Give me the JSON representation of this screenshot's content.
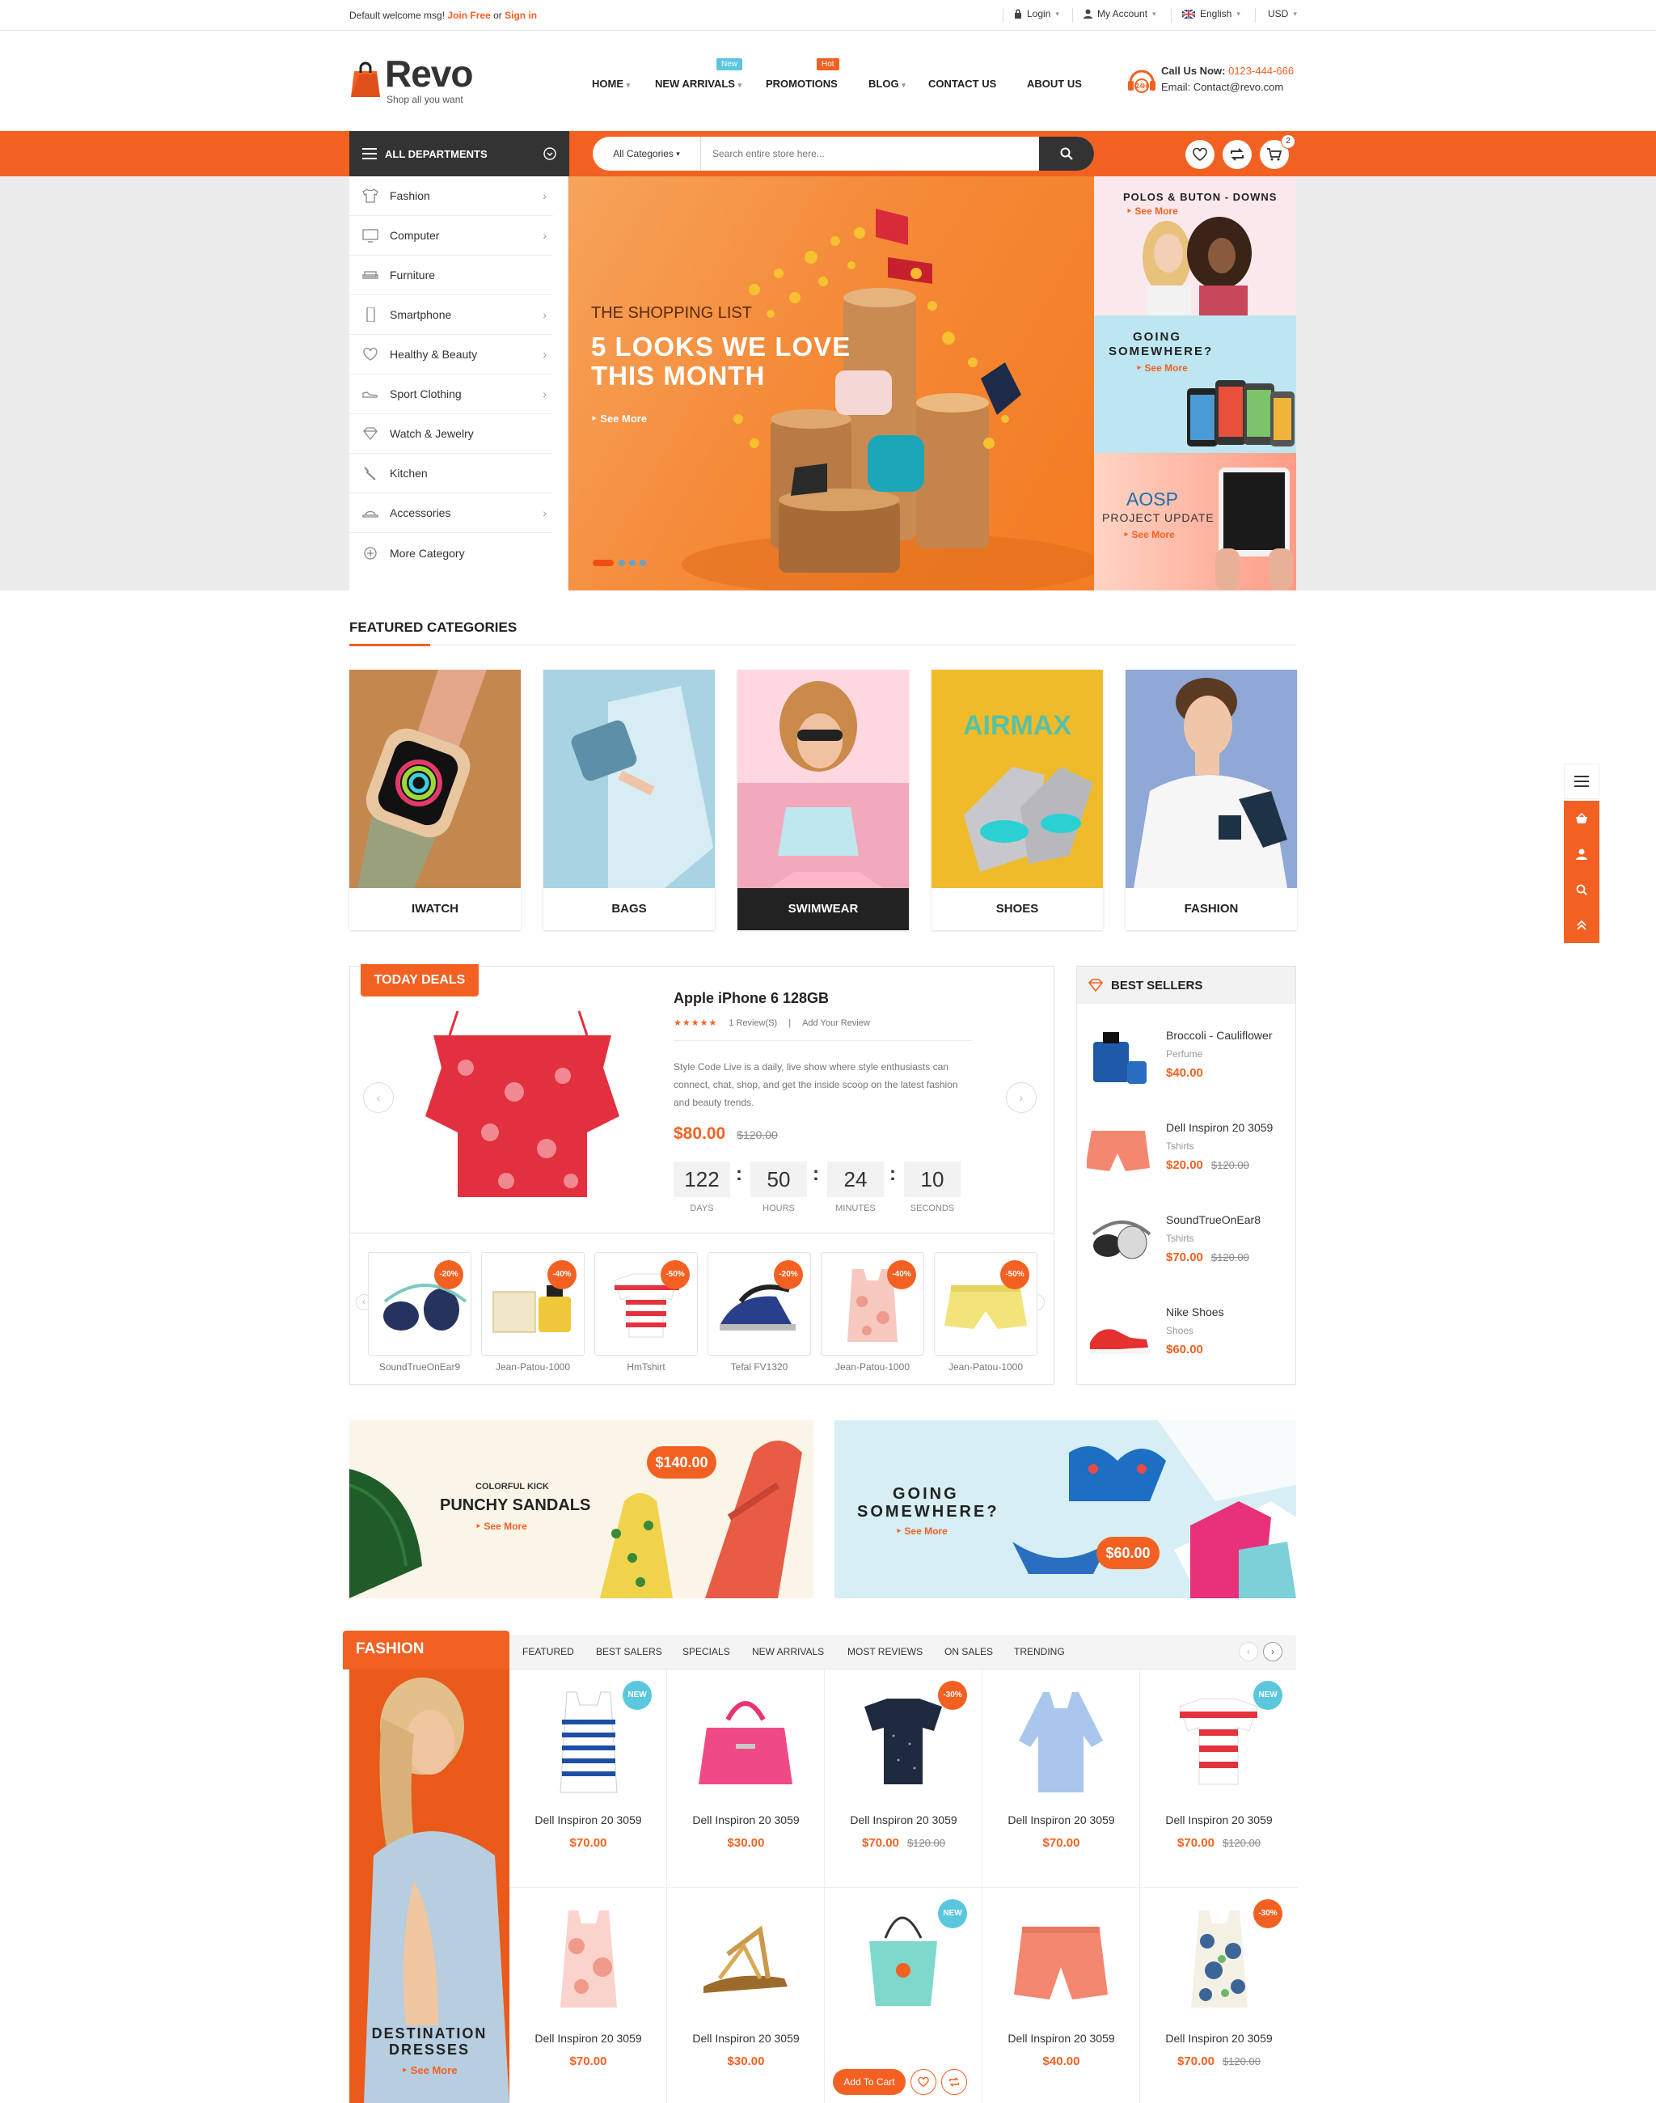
{
  "topbar": {
    "welcome": "Default welcome msg!",
    "join": "Join Free",
    "or": "or",
    "signin": "Sign in",
    "login": "Login",
    "account": "My Account",
    "language": "English",
    "currency": "USD"
  },
  "header": {
    "logo": "Revo",
    "tagline": "Shop all you want",
    "nav": [
      "HOME",
      "NEW ARRIVALS",
      "PROMOTIONS",
      "BLOG",
      "CONTACT US",
      "ABOUT US"
    ],
    "new_tag": "New",
    "hot_tag": "Hot",
    "call_label": "Call Us Now:",
    "phone": "0123-444-666",
    "email_label": "Email:",
    "email": "Contact@revo.com"
  },
  "searchbar": {
    "departments": "ALL DEPARTMENTS",
    "category": "All Categories",
    "placeholder": "Search entire store here...",
    "cart_count": "2"
  },
  "sidebar": {
    "items": [
      "Fashion",
      "Computer",
      "Furniture",
      "Smartphone",
      "Healthy & Beauty",
      "Sport Clothing",
      "Watch & Jewelry",
      "Kitchen",
      "Accessories",
      "More Category"
    ]
  },
  "slider": {
    "kicker": "THE SHOPPING LIST",
    "title1": "5 LOOKS WE LOVE",
    "title2": "THIS MONTH",
    "cta": "See More"
  },
  "side_banners": {
    "b1_title": "POLOS & BUTON - DOWNS",
    "b1_cta": "See More",
    "b2_title1": "GOING",
    "b2_title2": "SOMEWHERE?",
    "b2_cta": "See More",
    "b3_title1": "AOSP",
    "b3_title2": "PROJECT UPDATE",
    "b3_cta": "See More"
  },
  "featured": {
    "heading": "FEATURED CATEGORIES",
    "cats": [
      "IWATCH",
      "BAGS",
      "SWIMWEAR",
      "SHOES",
      "FASHION"
    ]
  },
  "deals": {
    "label": "TODAY DEALS",
    "product": "Apple iPhone 6 128GB",
    "reviews": "1 Review(S)",
    "add_review": "Add Your Review",
    "desc": "Style Code Live is a daily, live show where style enthusiasts can connect, chat, shop, and get the inside scoop on the latest fashion and beauty trends.",
    "price": "$80.00",
    "old_price": "$120.00",
    "countdown": [
      "122",
      "50",
      "24",
      "10"
    ],
    "countdown_labels": [
      "DAYS",
      "HOURS",
      "MINUTES",
      "SECONDS"
    ],
    "rating": 4.5,
    "thumbs": [
      {
        "name": "SoundTrueOnEar9",
        "badge": "-20%"
      },
      {
        "name": "Jean-Patou-1000",
        "badge": "-40%"
      },
      {
        "name": "HmTshirt",
        "badge": "-50%"
      },
      {
        "name": "Tefal FV1320",
        "badge": "-20%"
      },
      {
        "name": "Jean-Patou-1000",
        "badge": "-40%"
      },
      {
        "name": "Jean-Patou-1000",
        "badge": "-50%"
      }
    ]
  },
  "bestsellers": {
    "heading": "BEST SELLERS",
    "items": [
      {
        "name": "Broccoli - Cauliflower",
        "cat": "Perfume",
        "price": "$40.00",
        "old": ""
      },
      {
        "name": "Dell Inspiron 20 3059",
        "cat": "Tshirts",
        "price": "$20.00",
        "old": "$120.00"
      },
      {
        "name": "SoundTrueOnEar8",
        "cat": "Tshirts",
        "price": "$70.00",
        "old": "$120.00"
      },
      {
        "name": "Nike Shoes",
        "cat": "Shoes",
        "price": "$60.00",
        "old": ""
      }
    ]
  },
  "promo": {
    "p1_kicker": "COLORFUL KICK",
    "p1_title": "PUNCHY SANDALS",
    "p1_cta": "See More",
    "p1_price": "$140.00",
    "p2_title1": "GOING",
    "p2_title2": "SOMEWHERE?",
    "p2_cta": "See More",
    "p2_price": "$60.00"
  },
  "fashion": {
    "label": "FASHION",
    "tabs": [
      "FEATURED",
      "BEST SALERS",
      "SPECIALS",
      "NEW ARRIVALS",
      "MOST REVIEWS",
      "ON SALES",
      "TRENDING"
    ],
    "banner_title1": "DESTINATION",
    "banner_title2": "DRESSES",
    "banner_cta": "See More",
    "add_to_cart": "Add To Cart",
    "products": [
      {
        "name": "Dell Inspiron 20 3059",
        "price": "$70.00",
        "old": "",
        "badge": "NEW"
      },
      {
        "name": "Dell Inspiron 20 3059",
        "price": "$30.00",
        "old": "",
        "badge": ""
      },
      {
        "name": "Dell Inspiron 20 3059",
        "price": "$70.00",
        "old": "$120.00",
        "badge": "-30%"
      },
      {
        "name": "Dell Inspiron 20 3059",
        "price": "$70.00",
        "old": "",
        "badge": ""
      },
      {
        "name": "Dell Inspiron 20 3059",
        "price": "$70.00",
        "old": "$120.00",
        "badge": "NEW"
      },
      {
        "name": "Dell Inspiron 20 3059",
        "price": "$70.00",
        "old": "",
        "badge": ""
      },
      {
        "name": "Dell Inspiron 20 3059",
        "price": "$30.00",
        "old": "",
        "badge": ""
      },
      {
        "name": "",
        "price": "",
        "old": "",
        "badge": "NEW"
      },
      {
        "name": "Dell Inspiron 20 3059",
        "price": "$40.00",
        "old": "",
        "badge": ""
      },
      {
        "name": "Dell Inspiron 20 3059",
        "price": "$70.00",
        "old": "$120.00",
        "badge": "-30%"
      }
    ]
  },
  "colors": {
    "accent": "#f26122",
    "dark": "#333333",
    "badge_new": "#5bc7de"
  }
}
